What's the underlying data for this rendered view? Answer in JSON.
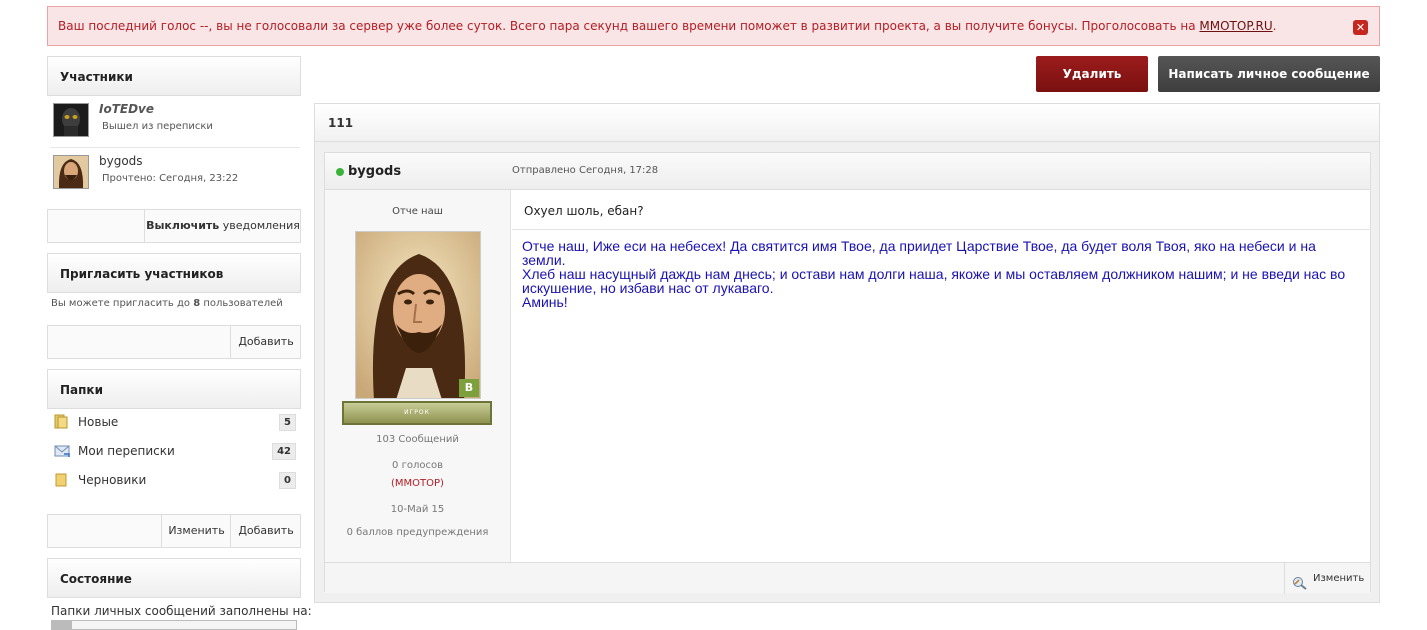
{
  "alert": {
    "text": "Ваш последний голос --, вы не голосовали за сервер уже более суток. Всего пара секунд вашего времени поможет в развитии проекта, а вы получите бонусы. Проголосовать на ",
    "link": "MMOTOP.RU",
    "tail": ".",
    "close": "✕"
  },
  "sidebar": {
    "participants_title": "Участники",
    "members": [
      {
        "name": "IoTEDve",
        "status": "Вышел из переписки"
      },
      {
        "name": "bygods",
        "status": "Прочтено: Сегодня, 23:22"
      }
    ],
    "notify_bold": "Выключить",
    "notify_rest": " уведомления",
    "invite_title": "Пригласить участников",
    "invite_hint_pre": "Вы можете пригласить до ",
    "invite_hint_num": "8",
    "invite_hint_post": " пользователей",
    "invite_add": "Добавить",
    "folders_title": "Папки",
    "folders": [
      {
        "label": "Новые",
        "count": "5",
        "icon": "folder-new-icon"
      },
      {
        "label": "Мои переписки",
        "count": "42",
        "icon": "mail-icon"
      },
      {
        "label": "Черновики",
        "count": "0",
        "icon": "folder-icon"
      }
    ],
    "folders_edit": "Изменить",
    "folders_add": "Добавить",
    "state_title": "Состояние",
    "state_text": "Папки личных сообщений заполнены на:"
  },
  "actions": {
    "delete": "Удалить",
    "write_pm": "Написать личное сообщение"
  },
  "topic": {
    "title": "111",
    "post": {
      "author": "bygods",
      "posted": "Отправлено Сегодня, 17:28",
      "user_title": "Отче наш",
      "badge": "B",
      "rank": "ИГРОК",
      "posts": "103 Сообщений",
      "votes": "0 голосов",
      "votes_link": "(MMOTOP)",
      "joined": "10-Май 15",
      "warn": "0 баллов предупреждения",
      "subject": "Охуел шоль, ебан?",
      "body_lines": [
        "Отче наш, Иже еси на небесех! Да святится имя Твое, да приидет Царствие Твое, да будет воля Твоя, яко на небеси и на земли.",
        "Хлеб наш насущный даждь нам днесь; и остави нам долги наша, якоже и мы оставляем должником нашим; и не введи нас во",
        "искушение, но избави нас от лукаваго.",
        "Аминь!"
      ],
      "edit": "Изменить"
    }
  },
  "colors": {
    "alert_text": "#b41d23",
    "delete_btn": "#8e1818",
    "pm_btn": "#464646",
    "message_text": "#1a12b0",
    "online_dot": "#3bb33b"
  }
}
